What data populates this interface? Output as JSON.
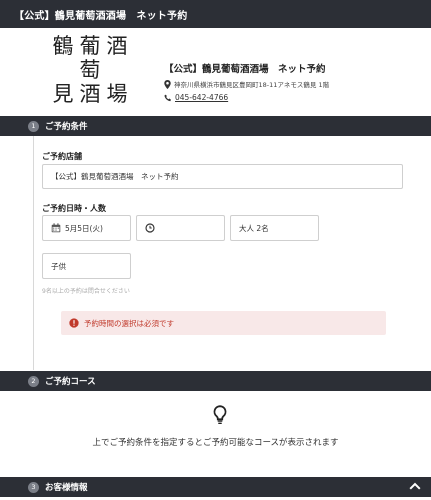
{
  "topbar": {
    "title": "【公式】鶴見葡萄酒酒場　ネット予約"
  },
  "logo": {
    "line1": "鶴葡酒",
    "line2": "萄",
    "line3": "見酒場"
  },
  "shop": {
    "name": "【公式】鶴見葡萄酒酒場　ネット予約",
    "address": "神奈川県横浜市鶴見区豊岡町18-11アネモス鶴見 1階",
    "phone": "045-642-4766"
  },
  "sections": [
    {
      "number": "1",
      "title": "ご予約条件"
    },
    {
      "number": "2",
      "title": "ご予約コース"
    },
    {
      "number": "3",
      "title": "お客様情報"
    }
  ],
  "form": {
    "store_label": "ご予約店舗",
    "store_value": "【公式】鶴見葡萄酒酒場　ネット予約",
    "datetime_label": "ご予約日時・人数",
    "date_value": "5月5日(火)",
    "time_value": "",
    "adults_value": "大人 2名",
    "children_value": "子供",
    "help_text": "9名以上の予約は問合せください",
    "error_text": "予約時間の選択は必須です"
  },
  "course": {
    "message": "上でご予約条件を指定するとご予約可能なコースが表示されます"
  },
  "colors": {
    "dark_bar": "#2c2f36",
    "error_text": "#c0392b",
    "error_bg": "#f8e8e8"
  }
}
